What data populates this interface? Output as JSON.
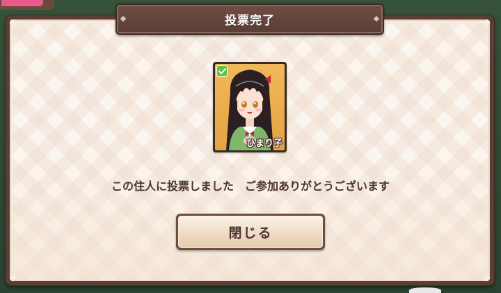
{
  "dialog": {
    "title": "投票完了",
    "message": "この住人に投票しました　ご参加ありがとうございます",
    "close_label": "閉じる"
  },
  "character": {
    "name": "ひまり子",
    "voted": true
  },
  "colors": {
    "frame": "#5a3e36",
    "panel": "#fbf5ef",
    "text": "#4a3430",
    "check": "#5cc24a",
    "card_bg": "#e6a341"
  },
  "icons": {
    "check": "check-icon"
  }
}
